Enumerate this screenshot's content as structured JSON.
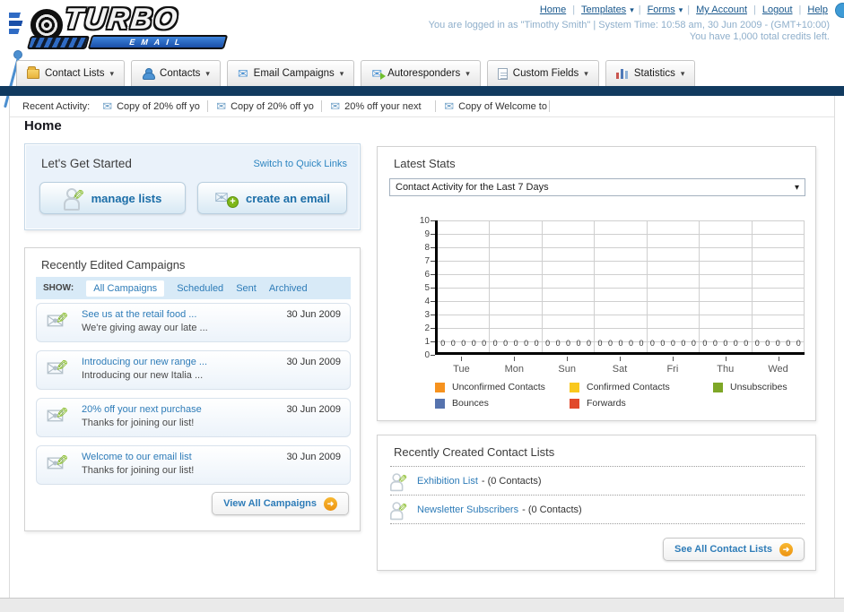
{
  "header": {
    "logo": {
      "title": "TURBO",
      "subtitle": "EMAIL"
    },
    "nav_links": [
      {
        "label": "Home",
        "dropdown": false
      },
      {
        "label": "Templates",
        "dropdown": true
      },
      {
        "label": "Forms",
        "dropdown": true
      },
      {
        "label": "My Account",
        "dropdown": false
      },
      {
        "label": "Logout",
        "dropdown": false
      },
      {
        "label": "Help",
        "dropdown": false
      }
    ],
    "login_info": "You are logged in as \"Timothy Smith\" | System Time: 10:58 am, 30 Jun 2009 - (GMT+10:00)",
    "credits_info": "You have 1,000 total credits left."
  },
  "nav_tabs": [
    {
      "label": "Contact Lists",
      "icon": "folder"
    },
    {
      "label": "Contacts",
      "icon": "person"
    },
    {
      "label": "Email Campaigns",
      "icon": "mail"
    },
    {
      "label": "Autoresponders",
      "icon": "mail-arrow"
    },
    {
      "label": "Custom Fields",
      "icon": "doc"
    },
    {
      "label": "Statistics",
      "icon": "bars"
    }
  ],
  "recent_activity": {
    "label": "Recent Activity:",
    "items": [
      "Copy of 20% off yo",
      "Copy of 20% off yo",
      "20% off your next ",
      "Copy of Welcome to"
    ]
  },
  "page_title": "Home",
  "get_started": {
    "title": "Let's Get Started",
    "switch_link": "Switch to Quick Links",
    "manage_lists_label": "manage lists",
    "create_email_label": "create an email"
  },
  "campaigns_panel": {
    "title": "Recently Edited Campaigns",
    "show_label": "SHOW:",
    "filters": [
      "All Campaigns",
      "Scheduled",
      "Sent",
      "Archived"
    ],
    "active_filter": "All Campaigns",
    "items": [
      {
        "title": "See us at the retail food ...",
        "subtitle": "We're giving away our late ...",
        "date": "30 Jun 2009"
      },
      {
        "title": "Introducing our new range ...",
        "subtitle": "Introducing our new Italia ...",
        "date": "30 Jun 2009"
      },
      {
        "title": "20% off your next purchase",
        "subtitle": "Thanks for joining our list!",
        "date": "30 Jun 2009"
      },
      {
        "title": "Welcome to our email list",
        "subtitle": "Thanks for joining our list!",
        "date": "30 Jun 2009"
      }
    ],
    "view_all_label": "View All Campaigns"
  },
  "stats_panel": {
    "title": "Latest Stats",
    "dropdown_value": "Contact Activity for the Last 7 Days"
  },
  "chart_data": {
    "type": "bar",
    "title": "Contact Activity for the Last 7 Days",
    "categories": [
      "Tue",
      "Mon",
      "Sun",
      "Sat",
      "Fri",
      "Thu",
      "Wed"
    ],
    "series": [
      {
        "name": "Unconfirmed Contacts",
        "color": "#F6921E",
        "values": [
          0,
          0,
          0,
          0,
          0,
          0,
          0
        ]
      },
      {
        "name": "Confirmed Contacts",
        "color": "#F9C81D",
        "values": [
          0,
          0,
          0,
          0,
          0,
          0,
          0
        ]
      },
      {
        "name": "Unsubscribes",
        "color": "#7EA727",
        "values": [
          0,
          0,
          0,
          0,
          0,
          0,
          0
        ]
      },
      {
        "name": "Bounces",
        "color": "#5673AE",
        "values": [
          0,
          0,
          0,
          0,
          0,
          0,
          0
        ]
      },
      {
        "name": "Forwards",
        "color": "#E1492B",
        "values": [
          0,
          0,
          0,
          0,
          0,
          0,
          0
        ]
      }
    ],
    "ylim": [
      0,
      10
    ],
    "ytick_step": 1,
    "grid": true,
    "legend_position": "bottom",
    "value_labels": true,
    "xlabel": "",
    "ylabel": ""
  },
  "contact_lists_panel": {
    "title": "Recently Created Contact Lists",
    "items": [
      {
        "name": "Exhibition List",
        "detail": "- (0 Contacts)"
      },
      {
        "name": "Newsletter Subscribers",
        "detail": "- (0 Contacts)"
      }
    ],
    "see_all_label": "See All Contact Lists"
  },
  "icons": {
    "envelope": "✉",
    "pencil": "✎",
    "caret": "▾",
    "arrow": "➜",
    "plus": "+"
  },
  "colors": {
    "navy_bar": "#113A5F",
    "link_blue": "#2E7CB8",
    "accent_orange": "#F2A71B",
    "pencil_green": "#7FB718"
  }
}
